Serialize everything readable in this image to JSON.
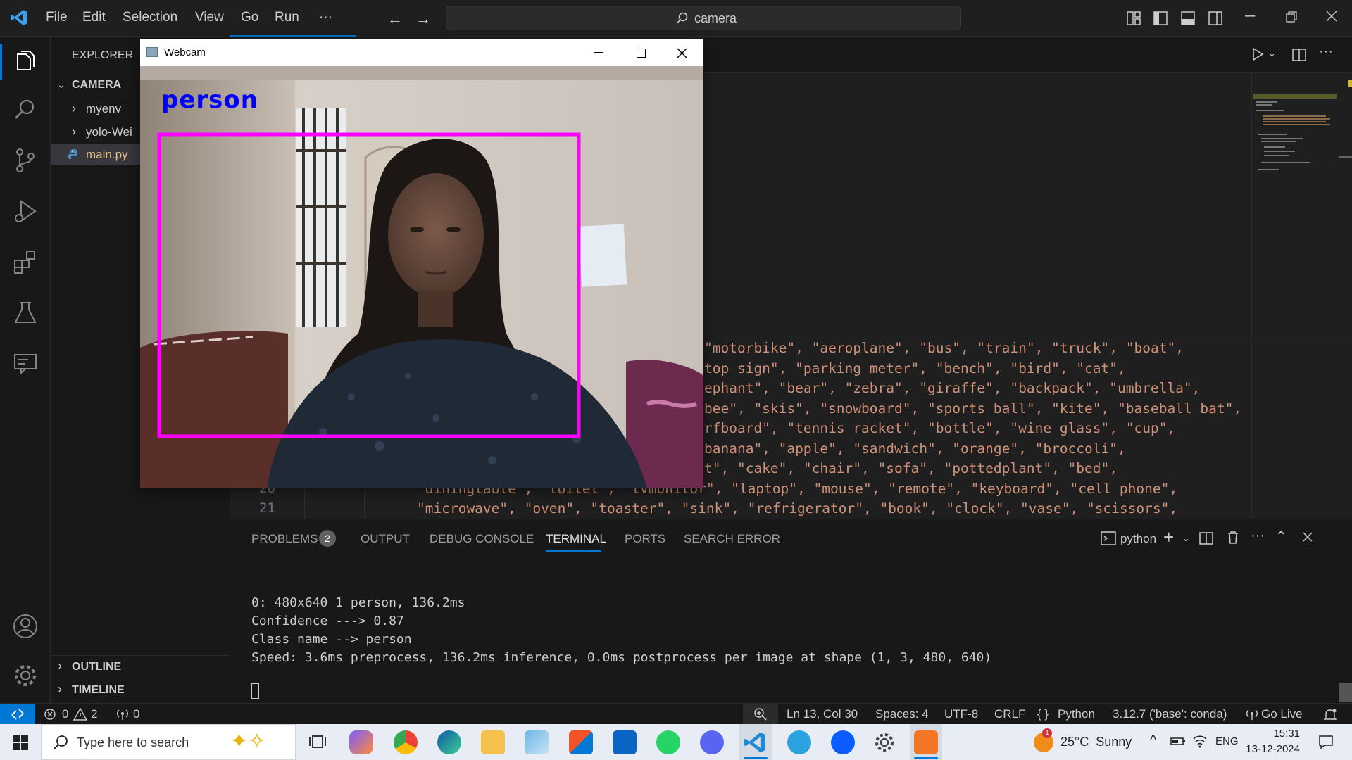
{
  "titlebar": {
    "menu": [
      "File",
      "Edit",
      "Selection",
      "View",
      "Go",
      "Run",
      "···"
    ],
    "search": "camera"
  },
  "sidebar": {
    "title": "EXPLORER",
    "folder": "CAMERA",
    "items": [
      {
        "label": "myenv",
        "type": "folder"
      },
      {
        "label": "yolo-Wei",
        "type": "folder"
      },
      {
        "label": "main.py",
        "type": "file"
      }
    ],
    "outline": "OUTLINE",
    "timeline": "TIMELINE"
  },
  "editor": {
    "lines": [
      {
        "num": "",
        "text": "\"motorbike\", \"aeroplane\", \"bus\", \"train\", \"truck\", \"boat\","
      },
      {
        "num": "",
        "text": "top sign\", \"parking meter\", \"bench\", \"bird\", \"cat\","
      },
      {
        "num": "",
        "text": "ephant\", \"bear\", \"zebra\", \"giraffe\", \"backpack\", \"umbrella\","
      },
      {
        "num": "",
        "text": "bee\", \"skis\", \"snowboard\", \"sports ball\", \"kite\", \"baseball bat\","
      },
      {
        "num": "",
        "text": "rfboard\", \"tennis racket\", \"bottle\", \"wine glass\", \"cup\","
      },
      {
        "num": "",
        "text": "banana\", \"apple\", \"sandwich\", \"orange\", \"broccoli\","
      },
      {
        "num": "",
        "text": "t\", \"cake\", \"chair\", \"sofa\", \"pottedplant\", \"bed\","
      },
      {
        "num": "20",
        "text": "\"diningtable\", \"toilet\", \"tvmonitor\", \"laptop\", \"mouse\", \"remote\", \"keyboard\", \"cell phone\","
      },
      {
        "num": "21",
        "text": "\"microwave\", \"oven\", \"toaster\", \"sink\", \"refrigerator\", \"book\", \"clock\", \"vase\", \"scissors\","
      }
    ]
  },
  "panel": {
    "tabs": [
      "PROBLEMS",
      "OUTPUT",
      "DEBUG CONSOLE",
      "TERMINAL",
      "PORTS",
      "SEARCH ERROR"
    ],
    "problems_count": "2",
    "shell": "python",
    "terminal_lines": [
      "0: 480x640 1 person, 136.2ms",
      "Confidence ---> 0.87",
      "Class name --> person",
      "Speed: 3.6ms preprocess, 136.2ms inference, 0.0ms postprocess per image at shape (1, 3, 480, 640)"
    ]
  },
  "statusbar": {
    "errors": "0",
    "warnings": "2",
    "ports": "0",
    "position": "Ln 13, Col 30",
    "spaces": "Spaces: 4",
    "encoding": "UTF-8",
    "eol": "CRLF",
    "language": "Python",
    "interpreter": "3.12.7 ('base': conda)",
    "golive": "Go Live"
  },
  "webcam": {
    "title": "Webcam",
    "detection_label": "person"
  },
  "taskbar": {
    "search_placeholder": "Type here to search",
    "weather": "25°C  Sunny",
    "lang": "ENG",
    "time": "15:31",
    "date": "13-12-2024",
    "notification_badge": "1"
  },
  "colors": {
    "accent": "#0078d4",
    "bbox": "#ff00ff",
    "label": "#0000ff"
  }
}
